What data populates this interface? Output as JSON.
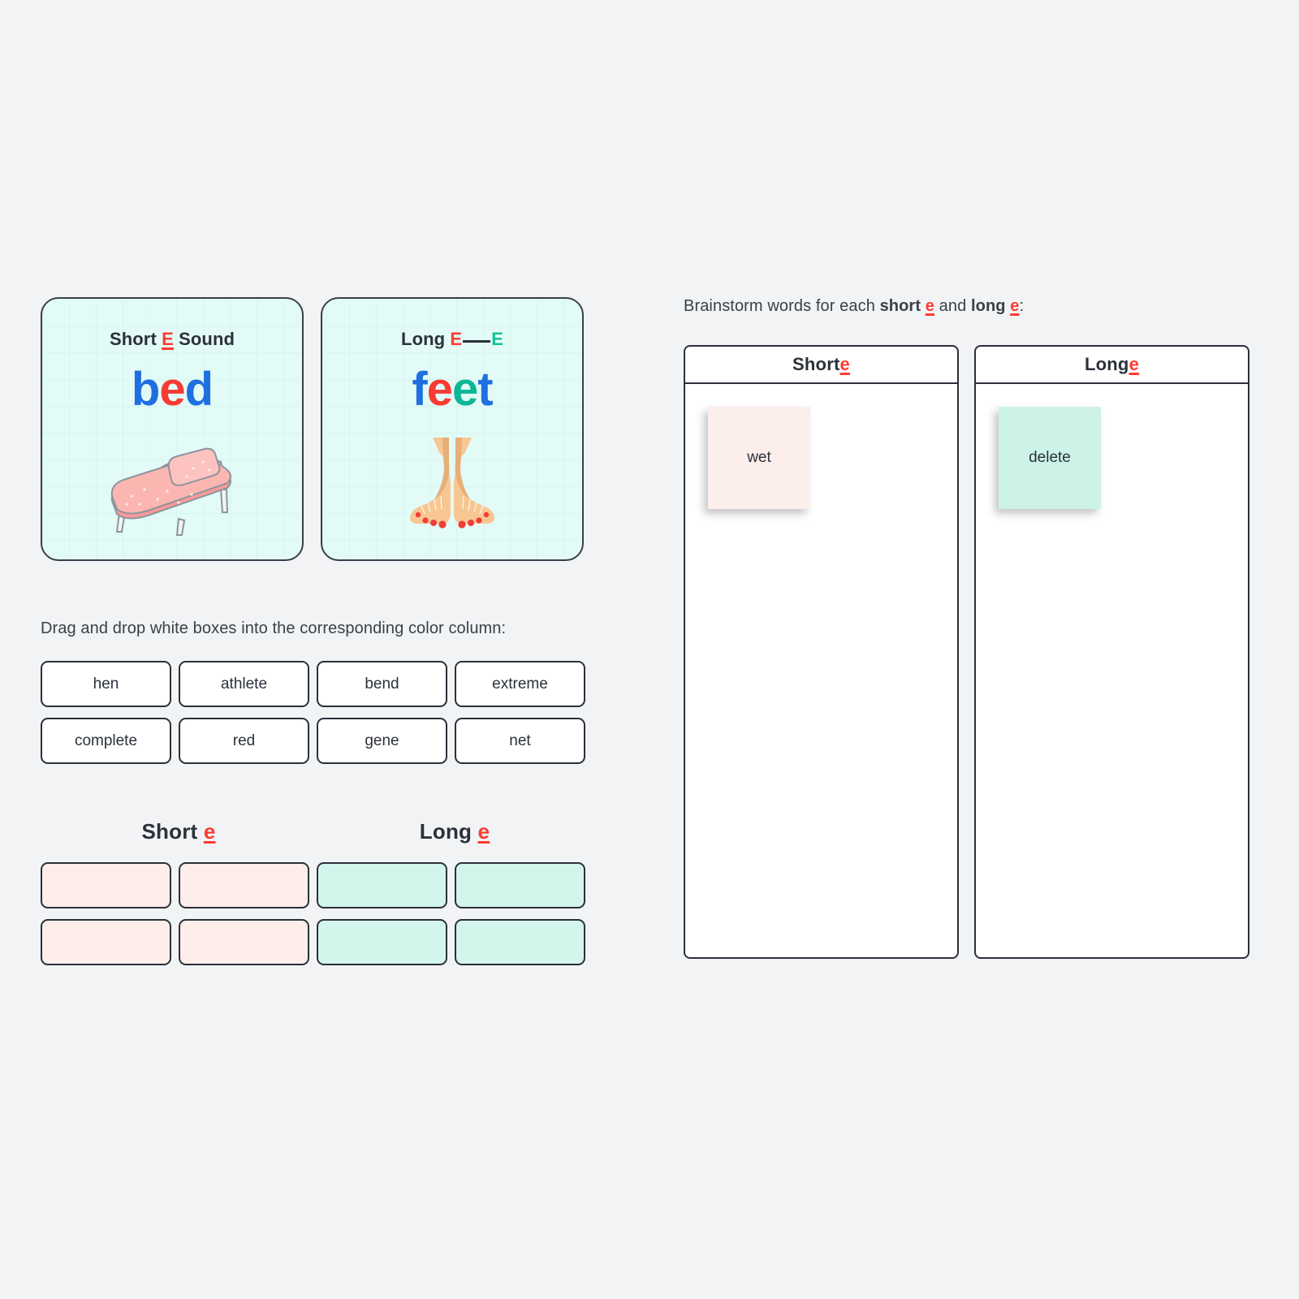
{
  "background_color": "#f1f3f5",
  "accent_colors": {
    "red": "#ff3b30",
    "teal": "#0eb795",
    "blue": "#1f6fe0",
    "ink": "#2b303a",
    "card_mint": "#e2fbf7",
    "slot_pink": "#fdeeea",
    "slot_teal": "#d2f5ec",
    "note_pink": "#fceeeb",
    "note_teal": "#cdf3e8"
  },
  "sound_cards": [
    {
      "heading_prefix": "Short ",
      "heading_letter": "E",
      "heading_suffix": " Sound",
      "word": "bed",
      "word_letters": [
        {
          "char": "b",
          "color": "blue"
        },
        {
          "char": "e",
          "color": "red"
        },
        {
          "char": "d",
          "color": "blue"
        }
      ],
      "illustration": "bed-illustration"
    },
    {
      "heading_prefix": "Long ",
      "heading_letter_first": "E",
      "heading_blank": "___",
      "heading_letter_last": "E",
      "word": "feet",
      "word_letters": [
        {
          "char": "f",
          "color": "blue"
        },
        {
          "char": "e",
          "color": "red"
        },
        {
          "char": "e",
          "color": "teal"
        },
        {
          "char": "t",
          "color": "blue"
        }
      ],
      "illustration": "feet-illustration"
    }
  ],
  "drag_activity": {
    "prompt": "Drag and drop white boxes into the corresponding color column:",
    "word_bank": [
      "hen",
      "athlete",
      "bend",
      "extreme",
      "complete",
      "red",
      "gene",
      "net"
    ],
    "columns": [
      {
        "label_prefix": "Short ",
        "label_letter": "e",
        "fill": "short"
      },
      {
        "label_prefix": "Long ",
        "label_letter": "e",
        "fill": "long"
      }
    ],
    "drop_slots": [
      "short",
      "short",
      "long",
      "long",
      "short",
      "short",
      "long",
      "long"
    ]
  },
  "brainstorm": {
    "prompt_part1": "Brainstorm words for each ",
    "prompt_bold1": "short ",
    "prompt_letter1": "e",
    "prompt_part2": " and ",
    "prompt_bold2": "long ",
    "prompt_letter2": "e",
    "prompt_part3": ":",
    "panels": [
      {
        "header_prefix": "Short ",
        "header_letter": "e",
        "notes": [
          {
            "text": "wet",
            "color": "pink"
          }
        ]
      },
      {
        "header_prefix": "Long ",
        "header_letter": "e",
        "notes": [
          {
            "text": "delete",
            "color": "teal"
          }
        ]
      }
    ]
  }
}
